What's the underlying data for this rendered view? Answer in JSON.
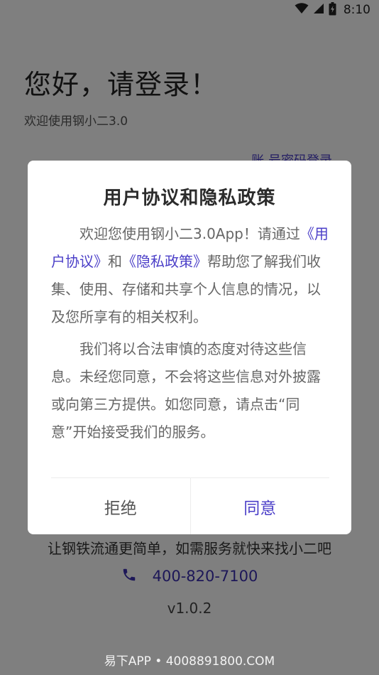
{
  "status_bar": {
    "time": "8:10"
  },
  "login": {
    "greeting": "您好，请登录！",
    "welcome": "欢迎使用钢小二3.0",
    "account_login_link": "账 号密码登录",
    "slogan": "让钢铁流通更简单，如需服务就快来找小二吧",
    "phone": "400-820-7100",
    "version": "v1.0.2"
  },
  "dialog": {
    "title": "用户协议和隐私政策",
    "p1_prefix": "欢迎您使用钢小二3.0App！请通过",
    "user_agreement_link": "《用户协议》",
    "p1_and": "和",
    "privacy_policy_link": "《隐私政策》",
    "p1_suffix": "帮助您了解我们收集、使用、存储和共享个人信息的情况，以及您所享有的相关权利。",
    "p2": "我们将以合法审慎的态度对待这些信息。未经您同意，不会将这些信息对外披露或向第三方提供。如您同意，请点击“同意”开始接受我们的服务。",
    "reject_label": "拒绝",
    "agree_label": "同意"
  },
  "watermark": "易下APP • 4008891800.COM",
  "colors": {
    "accent": "#4b3fc8",
    "overlay": "rgba(0,0,0,0.5)"
  },
  "icons": [
    "wifi-icon",
    "cellular-signal-icon",
    "battery-icon",
    "phone-icon"
  ]
}
